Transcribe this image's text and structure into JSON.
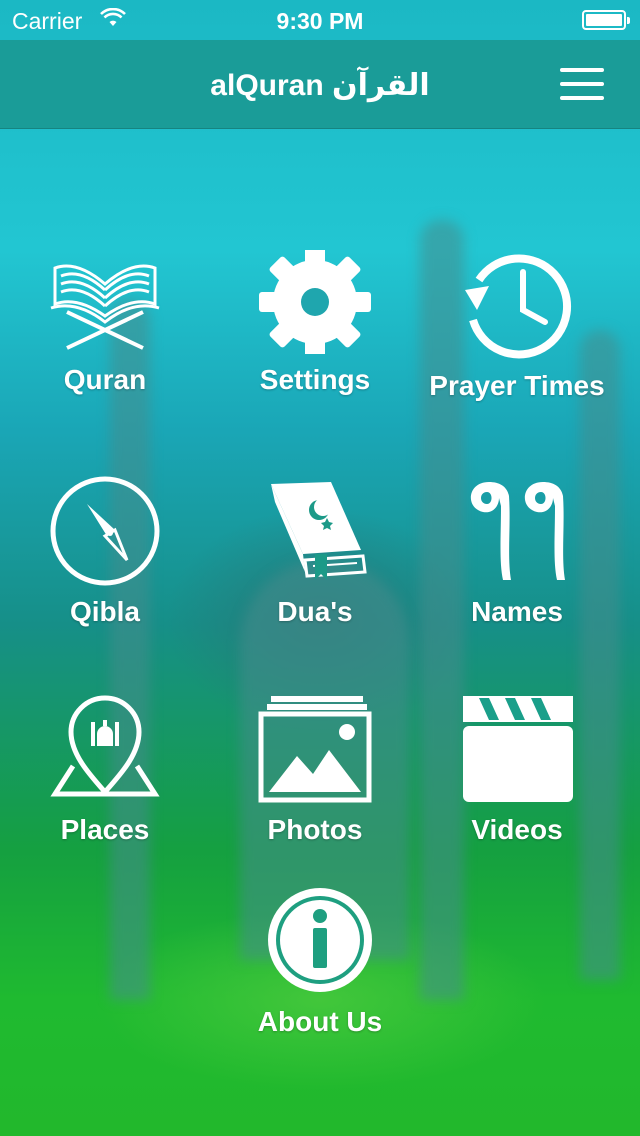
{
  "status_bar": {
    "carrier": "Carrier",
    "time": "9:30 PM"
  },
  "navbar": {
    "title": "alQuran القرآن",
    "menu_icon": "hamburger-menu-icon"
  },
  "colors": {
    "navbar": "#1a9c98",
    "text": "#ffffff"
  },
  "menu": [
    {
      "label": "Quran",
      "icon": "open-quran-book-icon"
    },
    {
      "label": "Settings",
      "icon": "gear-icon"
    },
    {
      "label": "Prayer Times",
      "icon": "clock-history-icon"
    },
    {
      "label": "Qibla",
      "icon": "compass-icon"
    },
    {
      "label": "Dua's",
      "icon": "crescent-book-icon"
    },
    {
      "label": "Names",
      "icon": "arabic-99-icon"
    },
    {
      "label": "Places",
      "icon": "mosque-location-pin-icon"
    },
    {
      "label": "Photos",
      "icon": "photo-gallery-icon"
    },
    {
      "label": "Videos",
      "icon": "clapperboard-icon"
    },
    {
      "label": "About Us",
      "icon": "info-icon"
    }
  ]
}
